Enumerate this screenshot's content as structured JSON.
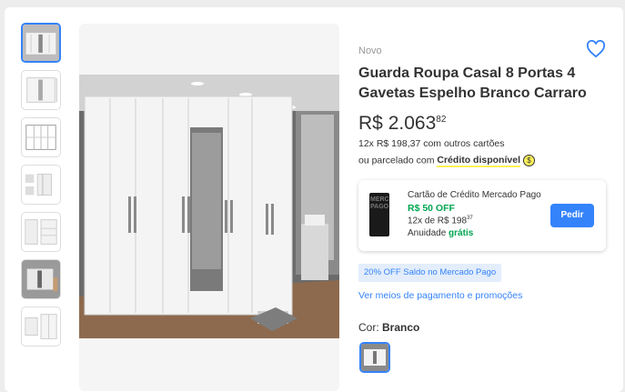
{
  "product": {
    "condition": "Novo",
    "title": "Guarda Roupa Casal 8 Portas 4 Gavetas Espelho Branco Carraro",
    "price_currency": "R$",
    "price_integer": "2.063",
    "price_cents": "82",
    "installments_text": "12x R$ 198,37 com outros cartões",
    "credit_prefix": "ou parcelado com ",
    "credit_highlight": "Crédito disponível",
    "credit_coin": "$"
  },
  "credit_card": {
    "card_image_text": "MERCADO PAGO",
    "title": "Cartão de Crédito Mercado Pago",
    "discount": "R$ 50 OFF",
    "installments_prefix": "12x de R$ 198",
    "installments_cents": "37",
    "annuity_label": "Anuidade ",
    "annuity_value": "grátis",
    "button_label": "Pedir"
  },
  "promo_badge": "20% OFF Saldo no Mercado Pago",
  "payment_link": "Ver meios de pagamento e promoções",
  "color": {
    "label": "Cor: ",
    "value": "Branco"
  },
  "thumbnails": [
    "main-photo",
    "front-view",
    "dimensions",
    "internal-layout",
    "internal-shelves",
    "room-photo",
    "drawer-detail"
  ],
  "colors": {
    "accent": "#3483fa",
    "green": "#00a650",
    "highlight": "#fff159"
  }
}
